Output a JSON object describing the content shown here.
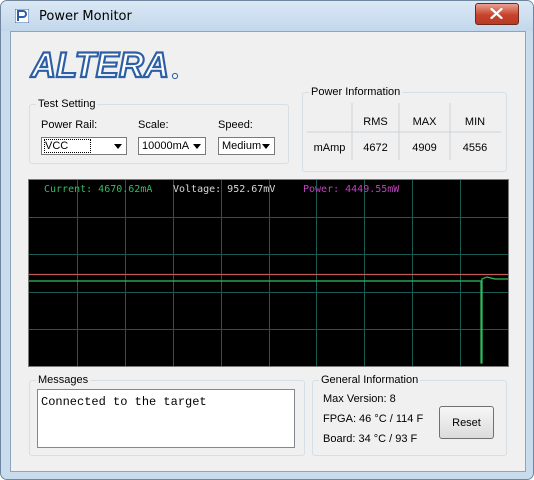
{
  "window": {
    "title": "Power Monitor",
    "close_label": "x"
  },
  "logo": {
    "text": "ALTERA"
  },
  "test_setting": {
    "title": "Test Setting",
    "power_rail": {
      "label": "Power Rail:",
      "value": "VCC"
    },
    "scale": {
      "label": "Scale:",
      "value": "10000mA"
    },
    "speed": {
      "label": "Speed:",
      "value": "Medium"
    }
  },
  "power_info": {
    "title": "Power Information",
    "headers": [
      "",
      "RMS",
      "MAX",
      "MIN"
    ],
    "row": {
      "unit": "mAmp",
      "rms": "4672",
      "max": "4909",
      "min": "4556"
    }
  },
  "plot": {
    "current": "Current: 4670.62mA",
    "voltage": "Voltage: 952.67mV",
    "power": "Power: 4449.55mW",
    "colors": {
      "background": "#000000",
      "grid": "#1a5a55",
      "current": "#2fbf5f",
      "voltage": "#c25a5a",
      "power": "#c040c0",
      "voltage_label": "#d8d8d8"
    }
  },
  "messages": {
    "title": "Messages",
    "text": "Connected to the target"
  },
  "general_info": {
    "title": "General Information",
    "max_version": "Max Version:  8",
    "fpga": "FPGA:  46 °C / 114 F",
    "board": "Board:  34 °C / 93 F",
    "reset_label": "Reset"
  },
  "colors": {
    "logo_blue": "#2d5fa6",
    "title_bar": "#c2d7ec",
    "close_red": "#c7432c"
  }
}
